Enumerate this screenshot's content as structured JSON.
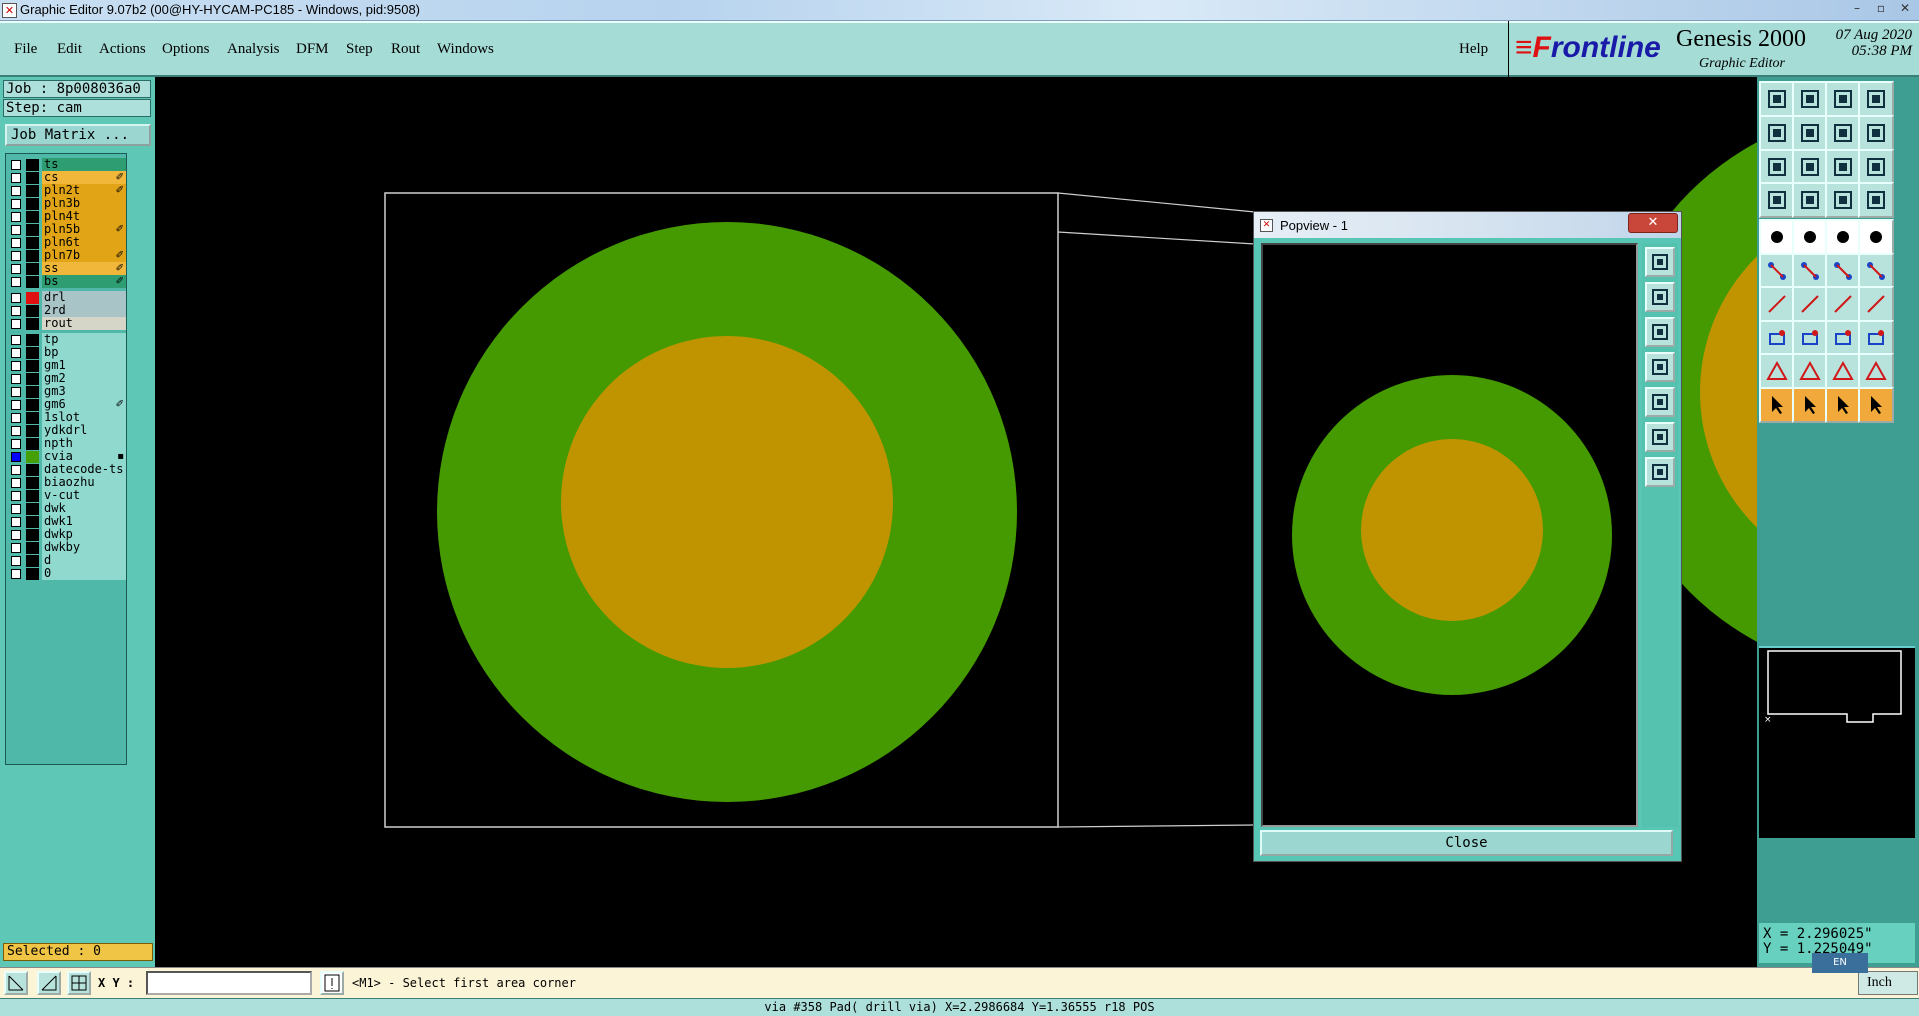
{
  "window": {
    "title": "Graphic Editor 9.07b2 (00@HY-HYCAM-PC185 - Windows, pid:9508)"
  },
  "menu": {
    "items": [
      "File",
      "Edit",
      "Actions",
      "Options",
      "Analysis",
      "DFM",
      "Step",
      "Rout",
      "Windows"
    ],
    "help": "Help"
  },
  "brand": {
    "logo_prefix": "≡F",
    "logo": "rontline",
    "product": "Genesis 2000",
    "subtitle": "Graphic Editor",
    "date": "07 Aug 2020",
    "time": "05:38 PM"
  },
  "job": {
    "job_label": "Job : 8p008036a0",
    "step_label": "Step: cam",
    "matrix_button": "Job Matrix ..."
  },
  "layers": [
    {
      "name": "ts",
      "color": "#2e9e72",
      "mark": ""
    },
    {
      "name": "cs",
      "color": "#f0b73a",
      "mark": "✐"
    },
    {
      "name": "pln2t",
      "color": "#e1a417",
      "mark": "✐"
    },
    {
      "name": "pln3b",
      "color": "#e1a417",
      "mark": ""
    },
    {
      "name": "pln4t",
      "color": "#e1a417",
      "mark": ""
    },
    {
      "name": "pln5b",
      "color": "#e1a417",
      "mark": "✐"
    },
    {
      "name": "pln6t",
      "color": "#e1a417",
      "mark": ""
    },
    {
      "name": "pln7b",
      "color": "#e1a417",
      "mark": "✐"
    },
    {
      "name": "ss",
      "color": "#f0b73a",
      "mark": "✐"
    },
    {
      "name": "bs",
      "color": "#2e9e72",
      "mark": "✐"
    },
    {
      "name": "drl",
      "color": "#a9c4c7",
      "mark": "",
      "swatch": "#e01010"
    },
    {
      "name": "2rd",
      "color": "#a9c4c7",
      "mark": ""
    },
    {
      "name": "rout",
      "color": "#d6d6c8",
      "mark": ""
    },
    {
      "name": "tp",
      "color": "#8fd9cf",
      "mark": ""
    },
    {
      "name": "bp",
      "color": "#8fd9cf",
      "mark": ""
    },
    {
      "name": "gm1",
      "color": "#8fd9cf",
      "mark": ""
    },
    {
      "name": "gm2",
      "color": "#8fd9cf",
      "mark": ""
    },
    {
      "name": "gm3",
      "color": "#8fd9cf",
      "mark": ""
    },
    {
      "name": "gm6",
      "color": "#8fd9cf",
      "mark": "✐"
    },
    {
      "name": "1slot",
      "color": "#8fd9cf",
      "mark": ""
    },
    {
      "name": "ydkdrl",
      "color": "#8fd9cf",
      "mark": ""
    },
    {
      "name": "npth",
      "color": "#8fd9cf",
      "mark": ""
    },
    {
      "name": "cvia",
      "color": "#8fd9cf",
      "mark": "▪",
      "swatch": "#45a008",
      "checked": true
    },
    {
      "name": "datecode-ts",
      "color": "#8fd9cf",
      "mark": ""
    },
    {
      "name": "biaozhu",
      "color": "#8fd9cf",
      "mark": ""
    },
    {
      "name": "v-cut",
      "color": "#8fd9cf",
      "mark": ""
    },
    {
      "name": "dwk",
      "color": "#8fd9cf",
      "mark": ""
    },
    {
      "name": "dwk1",
      "color": "#8fd9cf",
      "mark": ""
    },
    {
      "name": "dwkp",
      "color": "#8fd9cf",
      "mark": ""
    },
    {
      "name": "dwkby",
      "color": "#8fd9cf",
      "mark": ""
    },
    {
      "name": "d",
      "color": "#8fd9cf",
      "mark": ""
    },
    {
      "name": "0",
      "color": "#8fd9cf",
      "mark": ""
    }
  ],
  "selected": "Selected : 0",
  "coords": {
    "x": "X = 2.296025\"",
    "y": "Y = 1.225049\""
  },
  "bottom": {
    "xy_label": "X Y :",
    "xy_value": "",
    "prompt": "<M1> - Select first area corner",
    "unit": "Inch",
    "ime": "EN"
  },
  "status": "via #358 Pad( drill via) X=2.2986684 Y=1.36555 r18 POS",
  "popview": {
    "title": "Popview - 1",
    "close_x": "✕",
    "close_button": "Close"
  },
  "colors": {
    "copper_green": "#449a00",
    "pad_orange": "#bf9400",
    "panel_teal": "#5ec7b6"
  }
}
